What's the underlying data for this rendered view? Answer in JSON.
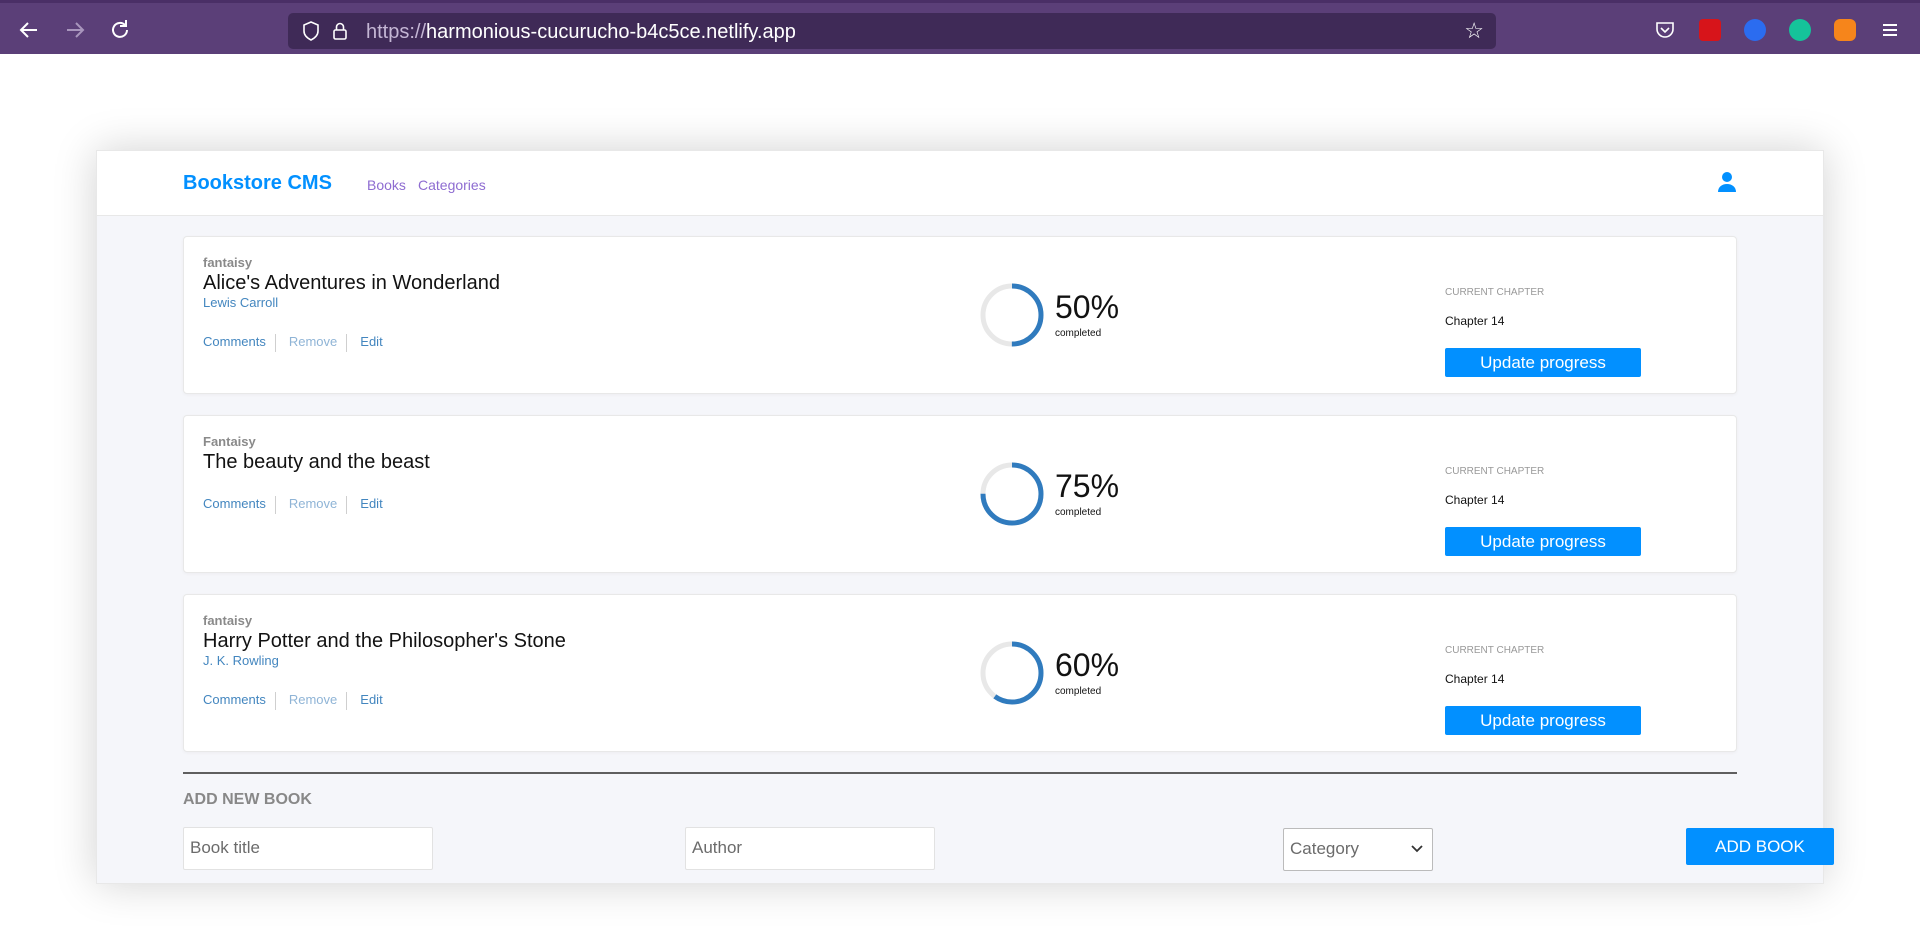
{
  "browser": {
    "url_protocol": "https://",
    "url_host": "harmonious-cucurucho-b4c5ce.netlify.app"
  },
  "header": {
    "brand": "Bookstore CMS",
    "nav": [
      "Books",
      "Categories"
    ]
  },
  "books": [
    {
      "genre": "fantaisy",
      "title": "Alice's Adventures in Wonderland",
      "author": "Lewis Carroll",
      "progress_percent": 50,
      "progress_label": "50%",
      "completed_label": "completed",
      "chapter_label": "CURRENT CHAPTER",
      "chapter": "Chapter 14",
      "update_label": "Update progress"
    },
    {
      "genre": "Fantaisy",
      "title": "The beauty and the beast",
      "author": "",
      "progress_percent": 75,
      "progress_label": "75%",
      "completed_label": "completed",
      "chapter_label": "CURRENT CHAPTER",
      "chapter": "Chapter 14",
      "update_label": "Update progress"
    },
    {
      "genre": "fantaisy",
      "title": "Harry Potter and the Philosopher's Stone",
      "author": "J. K. Rowling",
      "progress_percent": 60,
      "progress_label": "60%",
      "completed_label": "completed",
      "chapter_label": "CURRENT CHAPTER",
      "chapter": "Chapter 14",
      "update_label": "Update progress"
    }
  ],
  "actions": {
    "comments": "Comments",
    "remove": "Remove",
    "edit": "Edit"
  },
  "form": {
    "title": "ADD NEW BOOK",
    "title_placeholder": "Book title",
    "author_placeholder": "Author",
    "category_value": "Category",
    "submit_label": "ADD BOOK"
  },
  "colors": {
    "accent": "#0290ff",
    "link": "#4386bf",
    "nav_link": "#8e6cd1",
    "progress_stroke": "#307bbe",
    "progress_track": "#e8e8e8"
  },
  "icons": [
    "back-icon",
    "forward-icon",
    "reload-icon",
    "shield-icon",
    "lock-icon",
    "star-icon",
    "pocket-icon",
    "extension-icon",
    "grammarly-icon",
    "metamask-icon",
    "menu-icon",
    "user-icon",
    "chevron-down-icon"
  ]
}
